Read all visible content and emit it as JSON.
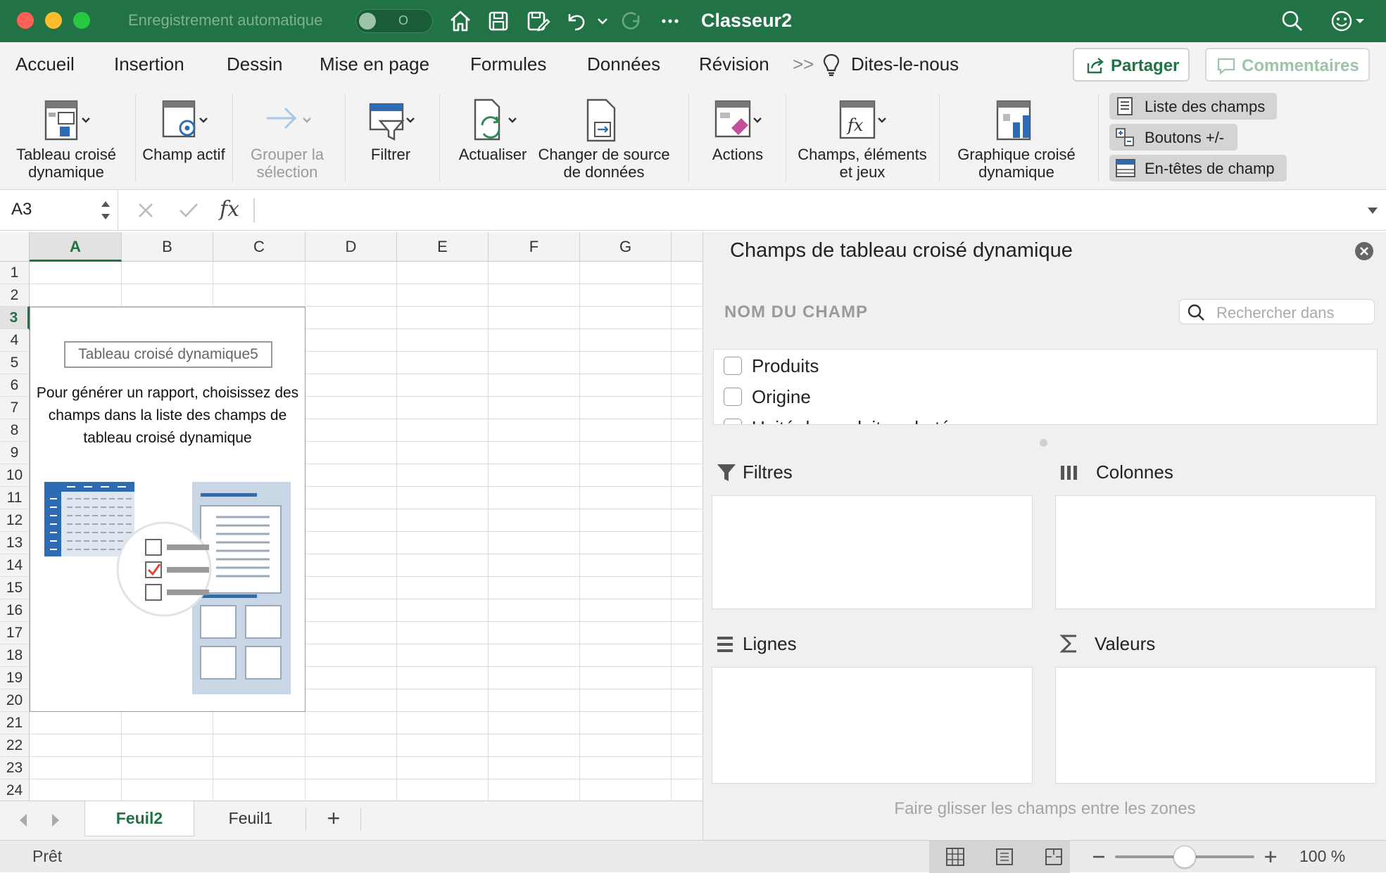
{
  "titlebar": {
    "autosave_label": "Enregistrement automatique",
    "autosave_toggle": "O",
    "doc_title": "Classeur2"
  },
  "menu": {
    "tabs": [
      "Accueil",
      "Insertion",
      "Dessin",
      "Mise en page",
      "Formules",
      "Données",
      "Révision"
    ],
    "more": ">>",
    "tell_me": "Dites-le-nous",
    "share": "Partager",
    "comments": "Commentaires"
  },
  "ribbon": {
    "pivot_table": "Tableau croisé dynamique",
    "active_field": "Champ actif",
    "group_selection": "Grouper la sélection",
    "filter": "Filtrer",
    "refresh": "Actualiser",
    "change_source": "Changer de source de données",
    "actions": "Actions",
    "fields_items_sets": "Champs, éléments et jeux",
    "pivot_chart": "Graphique croisé dynamique",
    "field_list": "Liste des champs",
    "plus_minus_buttons": "Boutons +/-",
    "field_headers": "En-têtes de champ"
  },
  "formula_bar": {
    "name_box": "A3",
    "fx": "fx",
    "value": ""
  },
  "grid": {
    "columns": [
      "A",
      "B",
      "C",
      "D",
      "E",
      "F",
      "G"
    ],
    "rows": [
      "1",
      "2",
      "3",
      "4",
      "5",
      "6",
      "7",
      "8",
      "9",
      "10",
      "11",
      "12",
      "13",
      "14",
      "15",
      "16",
      "17",
      "18",
      "19",
      "20",
      "21",
      "22",
      "23",
      "24"
    ],
    "selected_cell": "A3"
  },
  "pivot_placeholder": {
    "name": "Tableau croisé dynamique5",
    "message": "Pour générer un rapport, choisissez des champs dans la liste des champs de tableau croisé dynamique"
  },
  "sheets": {
    "tabs": [
      "Feuil2",
      "Feuil1"
    ],
    "active": "Feuil2",
    "add": "+"
  },
  "status": {
    "ready": "Prêt",
    "zoom": "100 %",
    "zoom_level_fraction": 0.5
  },
  "pane": {
    "title": "Champs de tableau croisé dynamique",
    "field_name_header": "NOM DU CHAMP",
    "search_placeholder": "Rechercher dans",
    "fields": [
      "Produits",
      "Origine",
      "Unité de produits achetés"
    ],
    "zones": {
      "filters": "Filtres",
      "columns": "Colonnes",
      "rows": "Lignes",
      "values": "Valeurs"
    },
    "hint": "Faire glisser les champs entre les zones"
  },
  "colors": {
    "excel_green": "#217346",
    "ribbon_bg": "#f3f3f3",
    "pane_bg": "#f0f0f0"
  }
}
